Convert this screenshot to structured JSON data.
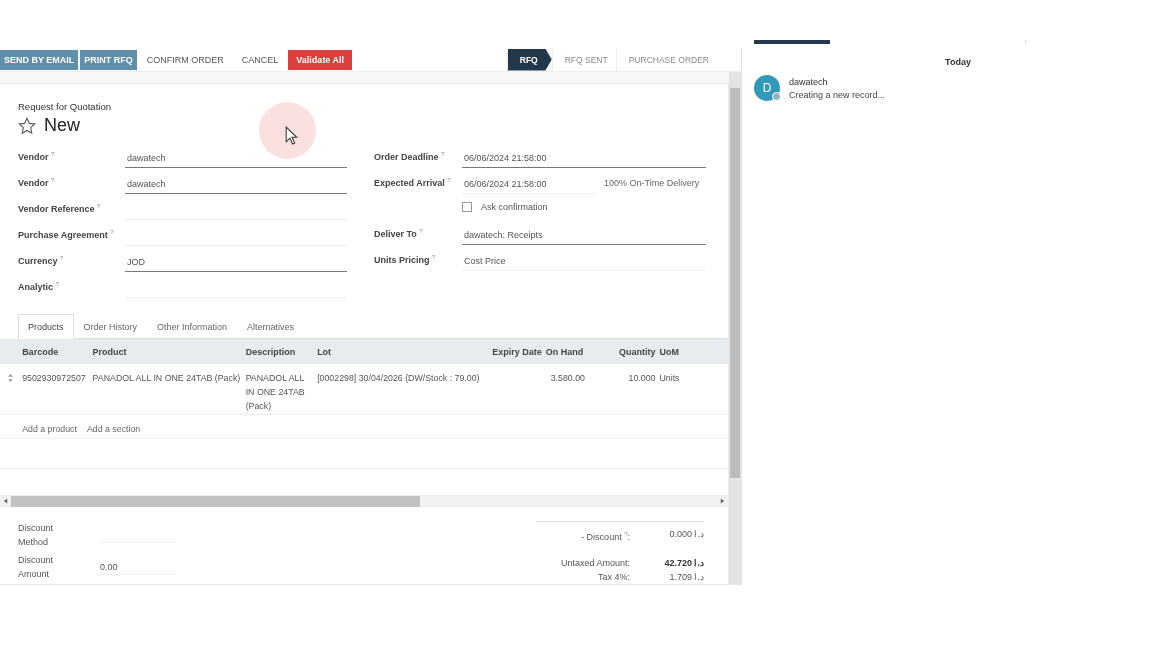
{
  "toolbar": {
    "buttons": [
      {
        "label": "SEND BY EMAIL",
        "kind": "primary"
      },
      {
        "label": "PRINT RFQ",
        "kind": "primary"
      },
      {
        "label": "CONFIRM ORDER",
        "kind": "plain"
      },
      {
        "label": "CANCEL",
        "kind": "plain"
      },
      {
        "label": "Validate All",
        "kind": "danger"
      }
    ],
    "stages": [
      {
        "label": "RFQ",
        "selected": true
      },
      {
        "label": "RFQ SENT",
        "selected": false
      },
      {
        "label": "PURCHASE ORDER",
        "selected": false
      }
    ]
  },
  "form": {
    "subtitle": "Request for Quotation",
    "title": "New",
    "favorite": false,
    "left_fields": [
      {
        "label": "Vendor",
        "help": "?",
        "value": "dawatech",
        "underlined": true
      },
      {
        "label": "Vendor",
        "help": "?",
        "value": "dawatech",
        "underlined": true
      },
      {
        "label": "Vendor Reference",
        "help": "?",
        "underlined": false
      },
      {
        "label": "Purchase Agreement",
        "help": "?",
        "underlined": false
      },
      {
        "label": "Currency",
        "help": "?",
        "value": "JOD",
        "underlined": true
      },
      {
        "label": "Analytic",
        "help": "?",
        "underlined": false
      }
    ],
    "right_fields": [
      {
        "kind": "field",
        "label": "Order Deadline",
        "help": "?",
        "value": "06/06/2024 21:58:00",
        "underlined": true
      },
      {
        "kind": "field",
        "label": "Expected Arrival",
        "help": "?",
        "value": "06/06/2024 21:58:00",
        "underlined": false,
        "note": "100% On-Time Delivery"
      },
      {
        "kind": "checkbox",
        "label": "Ask confirmation",
        "checked": false
      },
      {
        "kind": "field",
        "label": "Deliver To",
        "help": "?",
        "value": "dawatech: Receipts",
        "underlined": true
      },
      {
        "kind": "field",
        "label": "Units Pricing",
        "help": "?",
        "value": "Cost Price",
        "underlined": false
      }
    ]
  },
  "tabs": [
    {
      "label": "Products",
      "selected": true
    },
    {
      "label": "Order History",
      "selected": false
    },
    {
      "label": "Other Information",
      "selected": false
    },
    {
      "label": "Alternatives",
      "selected": false
    }
  ],
  "table": {
    "columns": [
      {
        "label": "Barcode"
      },
      {
        "label": "Product"
      },
      {
        "label": "Description"
      },
      {
        "label": "Lot"
      },
      {
        "label": "Expiry Date"
      },
      {
        "label": "On Hand"
      },
      {
        "label": "Quantity"
      },
      {
        "label": "UoM"
      }
    ],
    "rows": [
      {
        "cells": [
          "9502930972507",
          "PANADOL ALL IN ONE 24TAB (Pack)",
          "PANADOL ALL IN ONE 24TAB (Pack)",
          "[0002298] 30/04/2026 (DW/Stock : 79.00)",
          "",
          "3.580.00",
          "10.000",
          "Units"
        ]
      }
    ],
    "links": [
      "Add a product",
      "Add a section"
    ]
  },
  "footer": {
    "fields": [
      {
        "label": "Discount Method"
      },
      {
        "label": "Discount Amount",
        "value": "0.00"
      }
    ],
    "totals": [
      {
        "label": "- Discount",
        "help": "?",
        "suffix": ":",
        "value": "0.000",
        "currency": "د.ا",
        "bold": false
      },
      {
        "label": "Untaxed Amount:",
        "value": "42.720",
        "currency": "د.ا",
        "bold": true
      },
      {
        "label": "Tax 4%:",
        "value": "1.709",
        "currency": "د.ا",
        "bold": false
      }
    ]
  },
  "chatter": {
    "date": "Today",
    "messages": [
      {
        "avatar": "D",
        "author": "dawatech",
        "body": "Creating a new record..."
      }
    ]
  }
}
